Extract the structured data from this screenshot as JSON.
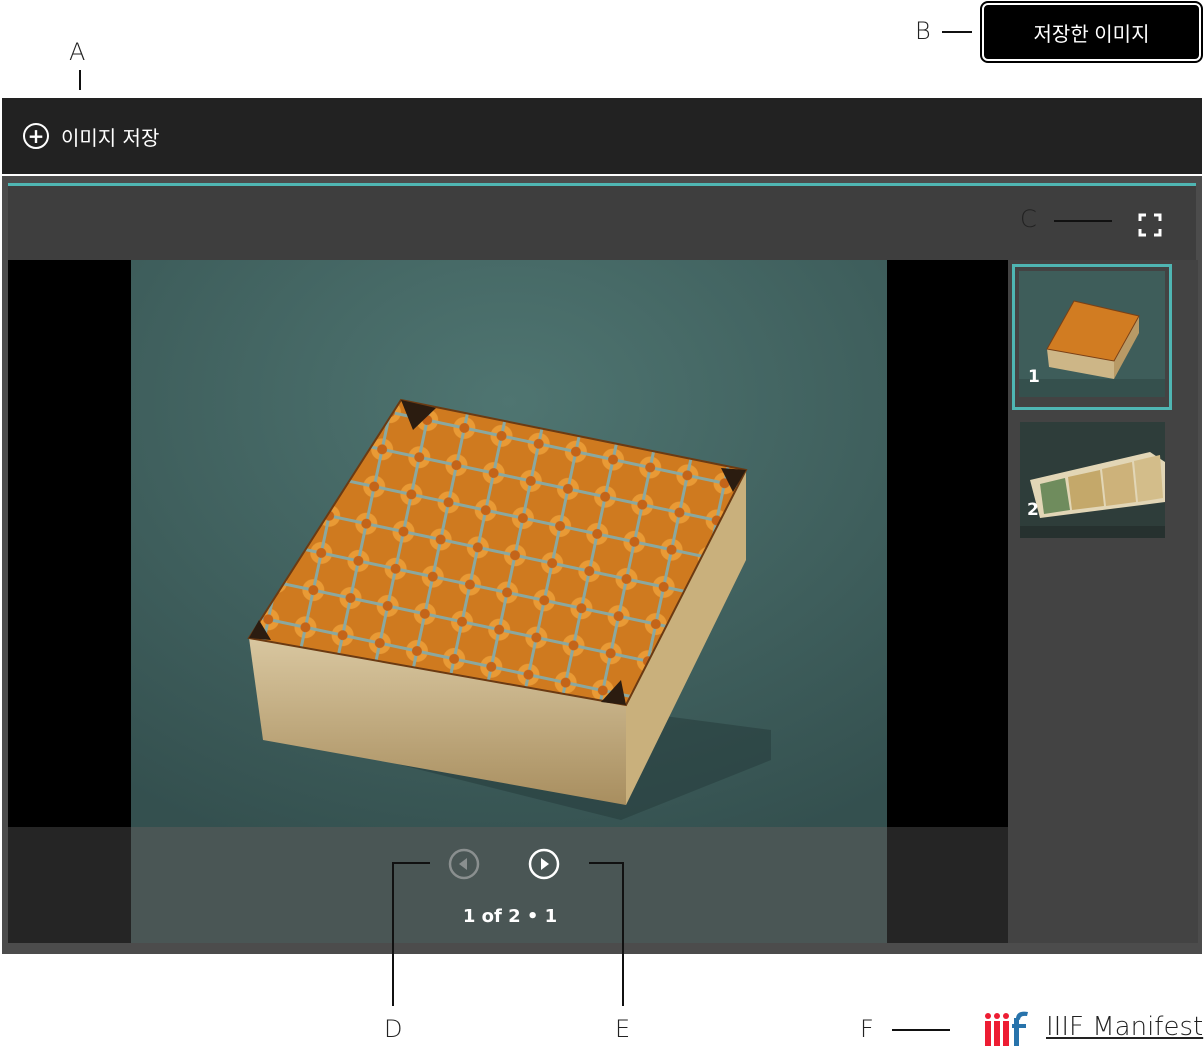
{
  "callouts": {
    "a": "A",
    "b": "B",
    "c": "C",
    "d": "D",
    "e": "E",
    "f": "F"
  },
  "saved_images_button": "저장한 이미지",
  "save_bar": {
    "label": "이미지 저장",
    "icon": "plus-circle-icon"
  },
  "viewer": {
    "accent_color": "#4fb6b3",
    "fullscreen_icon": "fullscreen-icon",
    "prev_icon": "prev-circle-icon",
    "next_icon": "next-circle-icon",
    "page_counter": "1 of 2 • 1",
    "thumbnails": [
      {
        "number": "1",
        "selected": true
      },
      {
        "number": "2",
        "selected": false
      }
    ]
  },
  "footer": {
    "iiif_logo": "iiif-logo",
    "manifest_link": "IIIF Manifest"
  }
}
